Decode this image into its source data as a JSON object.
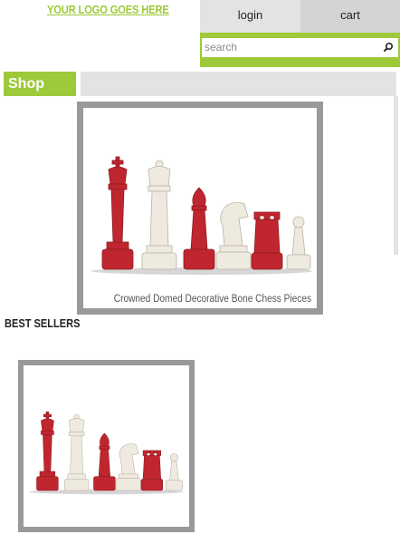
{
  "logo": {
    "text": "YOUR LOGO GOES HERE"
  },
  "nav": {
    "login": "login",
    "cart": "cart"
  },
  "search": {
    "placeholder": "search"
  },
  "shop": {
    "label": "Shop"
  },
  "featured": {
    "caption": "Crowned Domed Decorative Bone Chess Pieces"
  },
  "best_sellers": {
    "title": "BEST SELLERS"
  },
  "colors": {
    "accent": "#9dc93a",
    "nav_bg": "#e3e3e3",
    "frame": "#999999",
    "red_piece": "#c0262f",
    "white_piece": "#efeae0"
  }
}
